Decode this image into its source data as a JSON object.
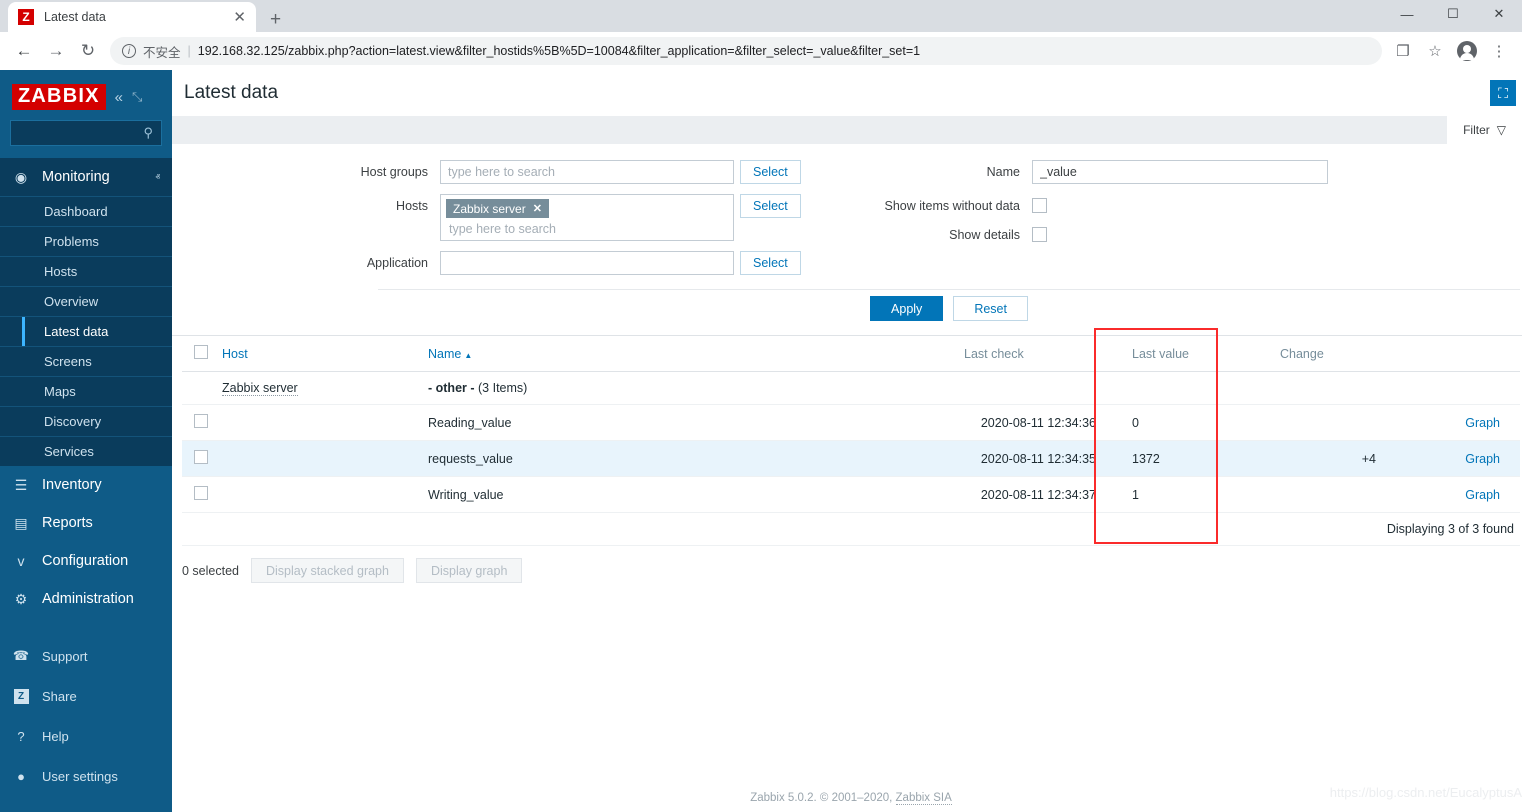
{
  "browser": {
    "tab_title": "Latest data",
    "favicon_letter": "Z",
    "close_glyph": "✕",
    "newtab_glyph": "+",
    "back_glyph": "←",
    "forward_glyph": "→",
    "reload_glyph": "↻",
    "info_glyph": "i",
    "security_label": "不安全",
    "url_separator": "|",
    "url": "192.168.32.125/zabbix.php?action=latest.view&filter_hostids%5B%5D=10084&filter_application=&filter_select=_value&filter_set=1",
    "translate_glyph": "❐",
    "bookmark_glyph": "☆",
    "menu_glyph": "⋮",
    "minimize_glyph": "—",
    "maximize_glyph": "☐",
    "close_window_glyph": "✕"
  },
  "sidebar": {
    "logo": "ZABBIX",
    "collapse_glyph": "«",
    "hide_glyph": "⤡",
    "search_placeholder": "",
    "search_value": "",
    "search_glyph": "⚲",
    "sections": [
      {
        "label": "Monitoring",
        "icon_glyph": "◉",
        "caret": "ⱏ",
        "active": true,
        "items": [
          {
            "label": "Dashboard",
            "current": false
          },
          {
            "label": "Problems",
            "current": false
          },
          {
            "label": "Hosts",
            "current": false
          },
          {
            "label": "Overview",
            "current": false
          },
          {
            "label": "Latest data",
            "current": true
          },
          {
            "label": "Screens",
            "current": false
          },
          {
            "label": "Maps",
            "current": false
          },
          {
            "label": "Discovery",
            "current": false
          },
          {
            "label": "Services",
            "current": false
          }
        ]
      },
      {
        "label": "Inventory",
        "icon_glyph": "☰",
        "caret": "ⱟ",
        "active": false,
        "items": []
      },
      {
        "label": "Reports",
        "icon_glyph": "▤",
        "caret": "ⱟ",
        "active": false,
        "items": []
      },
      {
        "label": "Configuration",
        "icon_glyph": "ᴠ",
        "caret": "ⱟ",
        "active": false,
        "items": []
      },
      {
        "label": "Administration",
        "icon_glyph": "⚙",
        "caret": "ⱟ",
        "active": false,
        "items": []
      }
    ],
    "utilities": [
      {
        "label": "Support",
        "icon_glyph": "☎"
      },
      {
        "label": "Share",
        "icon_glyph": "Z"
      },
      {
        "label": "Help",
        "icon_glyph": "?"
      },
      {
        "label": "User settings",
        "icon_glyph": "●"
      }
    ]
  },
  "header": {
    "title": "Latest data",
    "kiosk_glyph": "⛶"
  },
  "filter": {
    "tab_label": "Filter",
    "tab_icon_glyph": "▽",
    "host_groups": {
      "label": "Host groups",
      "placeholder": "type here to search",
      "value": "",
      "select_label": "Select"
    },
    "hosts": {
      "label": "Hosts",
      "chip": "Zabbix server",
      "chip_remove_glyph": "✕",
      "placeholder": "type here to search",
      "select_label": "Select"
    },
    "application": {
      "label": "Application",
      "placeholder": "",
      "value": "",
      "select_label": "Select"
    },
    "name": {
      "label": "Name",
      "value": "_value",
      "placeholder": ""
    },
    "show_items_without_data": {
      "label": "Show items without data",
      "checked": false
    },
    "show_details": {
      "label": "Show details",
      "checked": false
    },
    "apply_label": "Apply",
    "reset_label": "Reset"
  },
  "table": {
    "columns": {
      "host": "Host",
      "name": "Name",
      "name_sort_glyph": "▲",
      "last_check": "Last check",
      "last_value": "Last value",
      "change": "Change"
    },
    "group_row": {
      "host": "Zabbix server",
      "group_name": "- other -",
      "item_count": "(3 Items)"
    },
    "rows": [
      {
        "name": "Reading_value",
        "last_check": "2020-08-11 12:34:36",
        "last_value": "0",
        "change": "",
        "graph_label": "Graph",
        "highlighted": false
      },
      {
        "name": "requests_value",
        "last_check": "2020-08-11 12:34:35",
        "last_value": "1372",
        "change": "+4",
        "graph_label": "Graph",
        "highlighted": true
      },
      {
        "name": "Writing_value",
        "last_check": "2020-08-11 12:34:37",
        "last_value": "1",
        "change": "",
        "graph_label": "Graph",
        "highlighted": false
      }
    ],
    "displaying_text": "Displaying 3 of 3 found"
  },
  "actions": {
    "selected_count": "0 selected",
    "stacked_graph_label": "Display stacked graph",
    "graph_label": "Display graph"
  },
  "footer": {
    "version_text": "Zabbix 5.0.2. © 2001–2020, ",
    "company": "Zabbix SIA",
    "watermark": "https://blog.csdn.net/EucalyptusA"
  },
  "annotation": {
    "highlight_color": "#fa2b2b"
  }
}
